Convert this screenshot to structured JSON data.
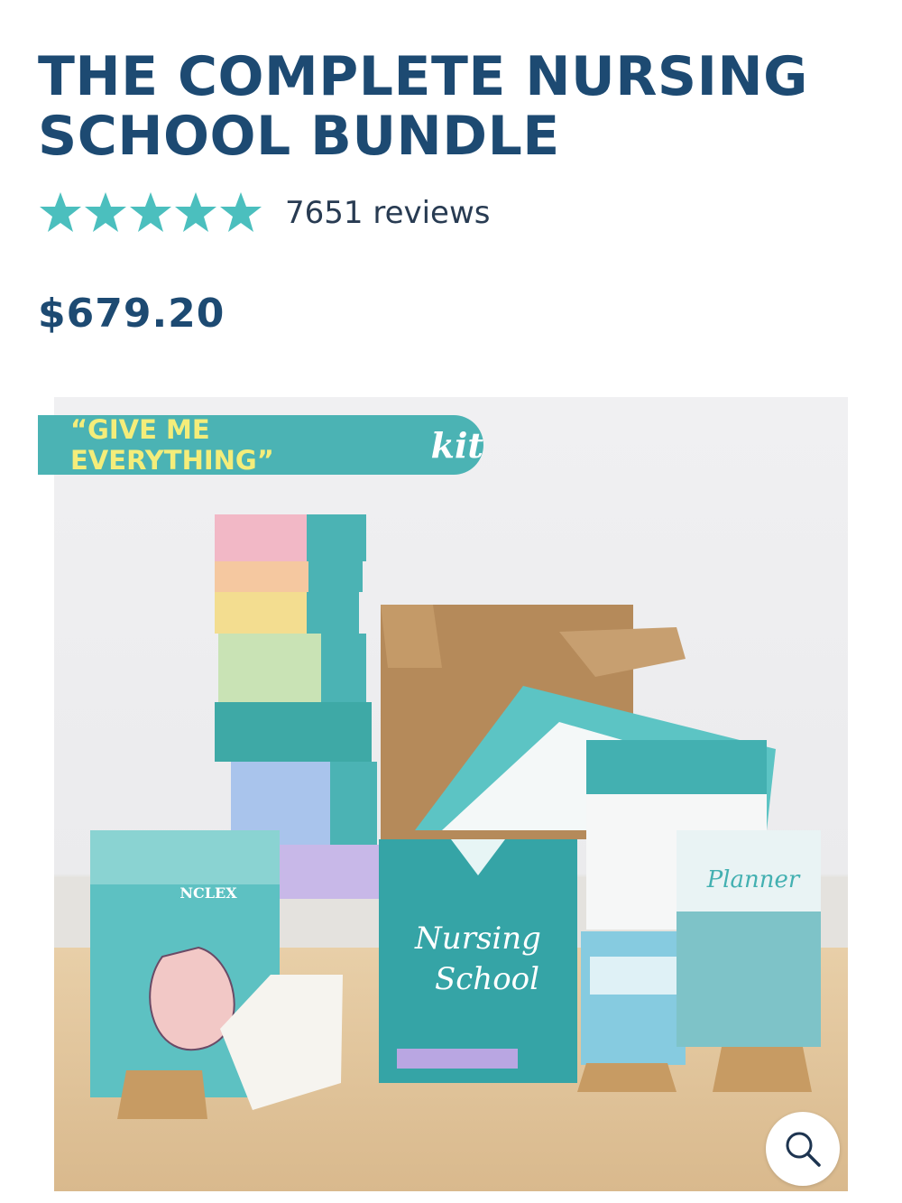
{
  "product": {
    "title_line1": "THE COMPLETE NURSING",
    "title_line2": "SCHOOL BUNDLE",
    "rating": 5,
    "reviews_text": "7651 reviews",
    "price": "$679.20"
  },
  "image": {
    "banner_text": "“GIVE ME EVERYTHING”",
    "banner_kit": "kit",
    "zoom_icon": "magnifier-icon"
  },
  "colors": {
    "title": "#1d4a72",
    "star": "#4bbfbe",
    "banner": "#4bb3b4",
    "banner_text": "#f4ed7a"
  }
}
